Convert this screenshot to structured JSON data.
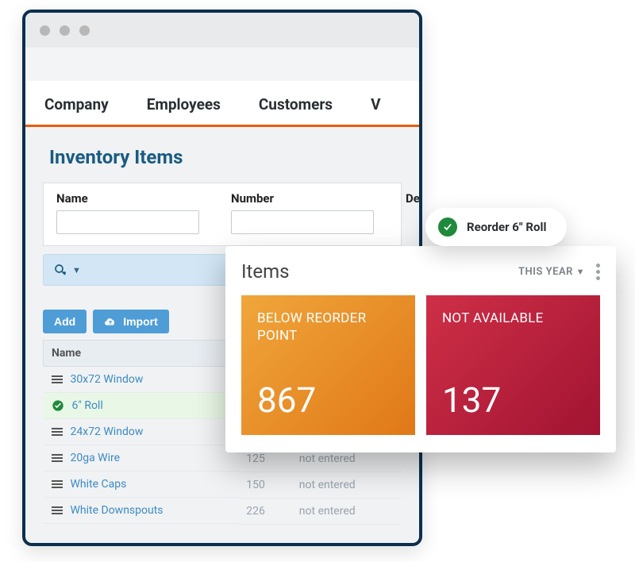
{
  "tabs": {
    "company": "Company",
    "employees": "Employees",
    "customers": "Customers",
    "extra": "V"
  },
  "section_title": "Inventory Items",
  "filters": {
    "name_label": "Name",
    "number_label": "Number",
    "desc_label": "De"
  },
  "toolbar": {
    "add": "Add",
    "import": "Import"
  },
  "table": {
    "col_name": "Name",
    "rows": [
      {
        "name": "30x72 Window",
        "qty": "",
        "note": ""
      },
      {
        "name": "6\" Roll",
        "qty": "",
        "note": ""
      },
      {
        "name": "24x72 Window",
        "qty": "",
        "note": ""
      },
      {
        "name": "20ga Wire",
        "qty": "125",
        "note": "not entered"
      },
      {
        "name": "White Caps",
        "qty": "150",
        "note": "not entered"
      },
      {
        "name": "White Downspouts",
        "qty": "226",
        "note": "not entered"
      }
    ]
  },
  "items_card": {
    "title": "Items",
    "range": "THIS YEAR",
    "tile1_label": "BELOW REORDER POINT",
    "tile1_value": "867",
    "tile2_label": "NOT AVAILABLE",
    "tile2_value": "137"
  },
  "reorder_pill": "Reorder 6\" Roll"
}
